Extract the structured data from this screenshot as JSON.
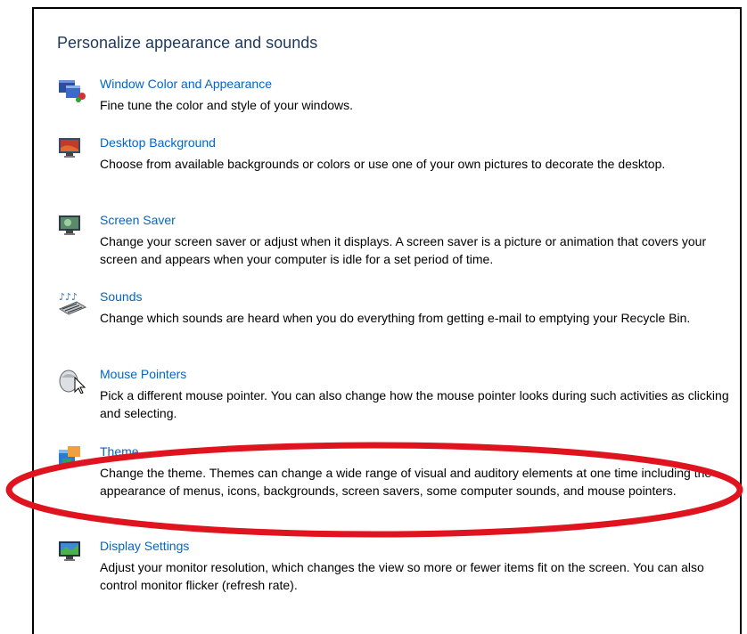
{
  "page": {
    "title": "Personalize appearance and sounds"
  },
  "items": [
    {
      "label": "Window Color and Appearance",
      "icon": "window-color-icon",
      "description": "Fine tune the color and style of your windows."
    },
    {
      "label": "Desktop Background",
      "icon": "desktop-background-icon",
      "description": "Choose from available backgrounds or colors or use one of your own pictures to decorate the desktop."
    },
    {
      "label": "Screen Saver",
      "icon": "screen-saver-icon",
      "description": "Change your screen saver or adjust when it displays. A screen saver is a picture or animation that covers your screen and appears when your computer is idle for a set period of time."
    },
    {
      "label": "Sounds",
      "icon": "sounds-icon",
      "description": "Change which sounds are heard when you do everything from getting e-mail to emptying your Recycle Bin."
    },
    {
      "label": "Mouse Pointers",
      "icon": "mouse-pointer-icon",
      "description": "Pick a different mouse pointer. You can also change how the mouse pointer looks during such activities as clicking and selecting."
    },
    {
      "label": "Theme",
      "icon": "theme-icon",
      "description": "Change the theme. Themes can change a wide range of visual and auditory elements at one time including the appearance of menus, icons, backgrounds, screen savers, some computer sounds, and mouse pointers."
    },
    {
      "label": "Display Settings",
      "icon": "display-settings-icon",
      "description": "Adjust your monitor resolution, which changes the view so more or fewer items fit on the screen. You can also control monitor flicker (refresh rate)."
    }
  ],
  "colors": {
    "link": "#0066cc",
    "title": "#1e395b",
    "highlight_ellipse": "#e0141e"
  }
}
